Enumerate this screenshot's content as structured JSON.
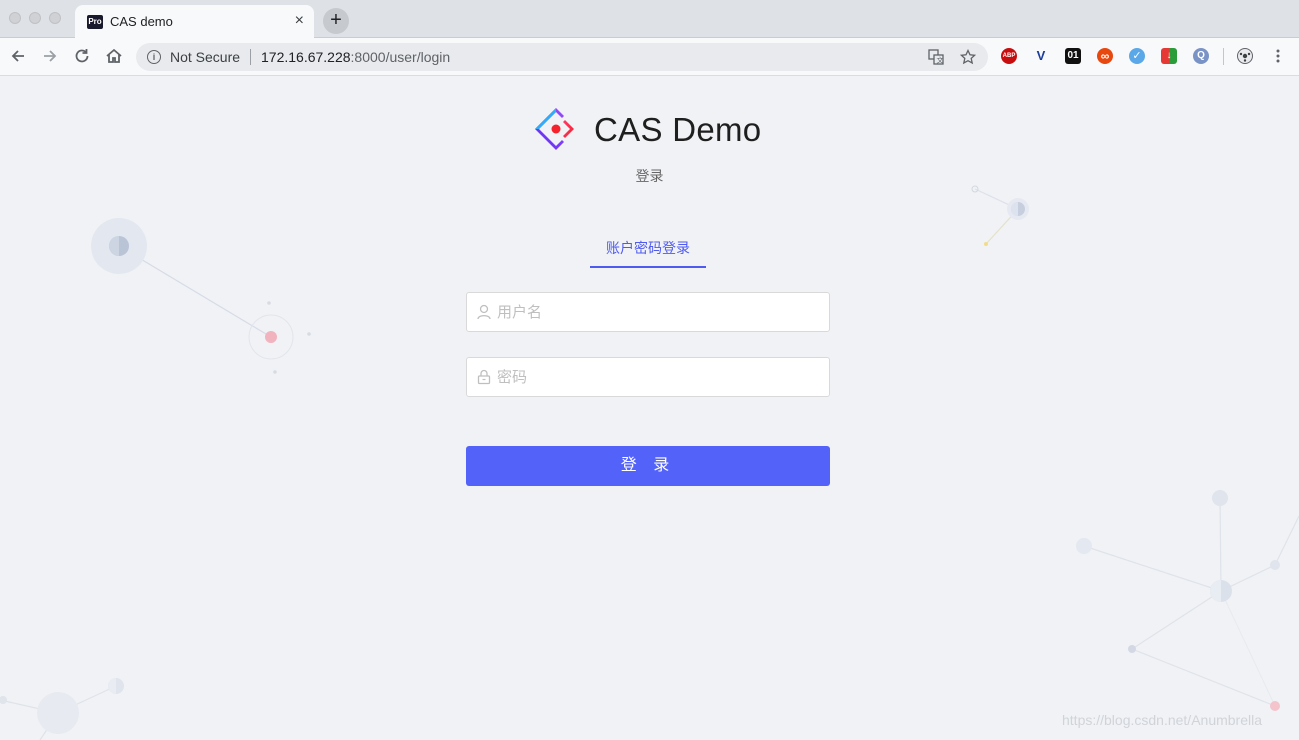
{
  "browser": {
    "tab_title": "CAS demo",
    "tab_favicon_text": "Pro",
    "tab_close": "×",
    "new_tab": "+",
    "security_label": "Not Secure",
    "url_host": "172.16.67.228",
    "url_rest": ":8000/user/login",
    "extensions": [
      {
        "name": "adblock-plus",
        "text": "ABP",
        "color": "#c70d0d"
      },
      {
        "name": "vimium",
        "text": "V",
        "color": "#1c3d9b"
      },
      {
        "name": "binary-01",
        "text": "01",
        "color": "#111111"
      },
      {
        "name": "infinity",
        "text": "∞",
        "color": "#e8470d"
      },
      {
        "name": "check",
        "text": "✓",
        "color": "#5aa8e8"
      },
      {
        "name": "colorful",
        "text": "↓",
        "color": "#2b9c3a"
      },
      {
        "name": "quicktime",
        "text": "Q",
        "color": "#7a93c7"
      }
    ]
  },
  "page": {
    "brand_title": "CAS Demo",
    "subtitle": "登录",
    "tab_label": "账户密码登录",
    "username_placeholder": "用户名",
    "password_placeholder": "密码",
    "login_button": "登 录",
    "watermark": "https://blog.csdn.net/Anumbrella"
  },
  "colors": {
    "primary": "#5362f9",
    "tab_active": "#4f5bf0",
    "background": "#f0f2f5"
  }
}
